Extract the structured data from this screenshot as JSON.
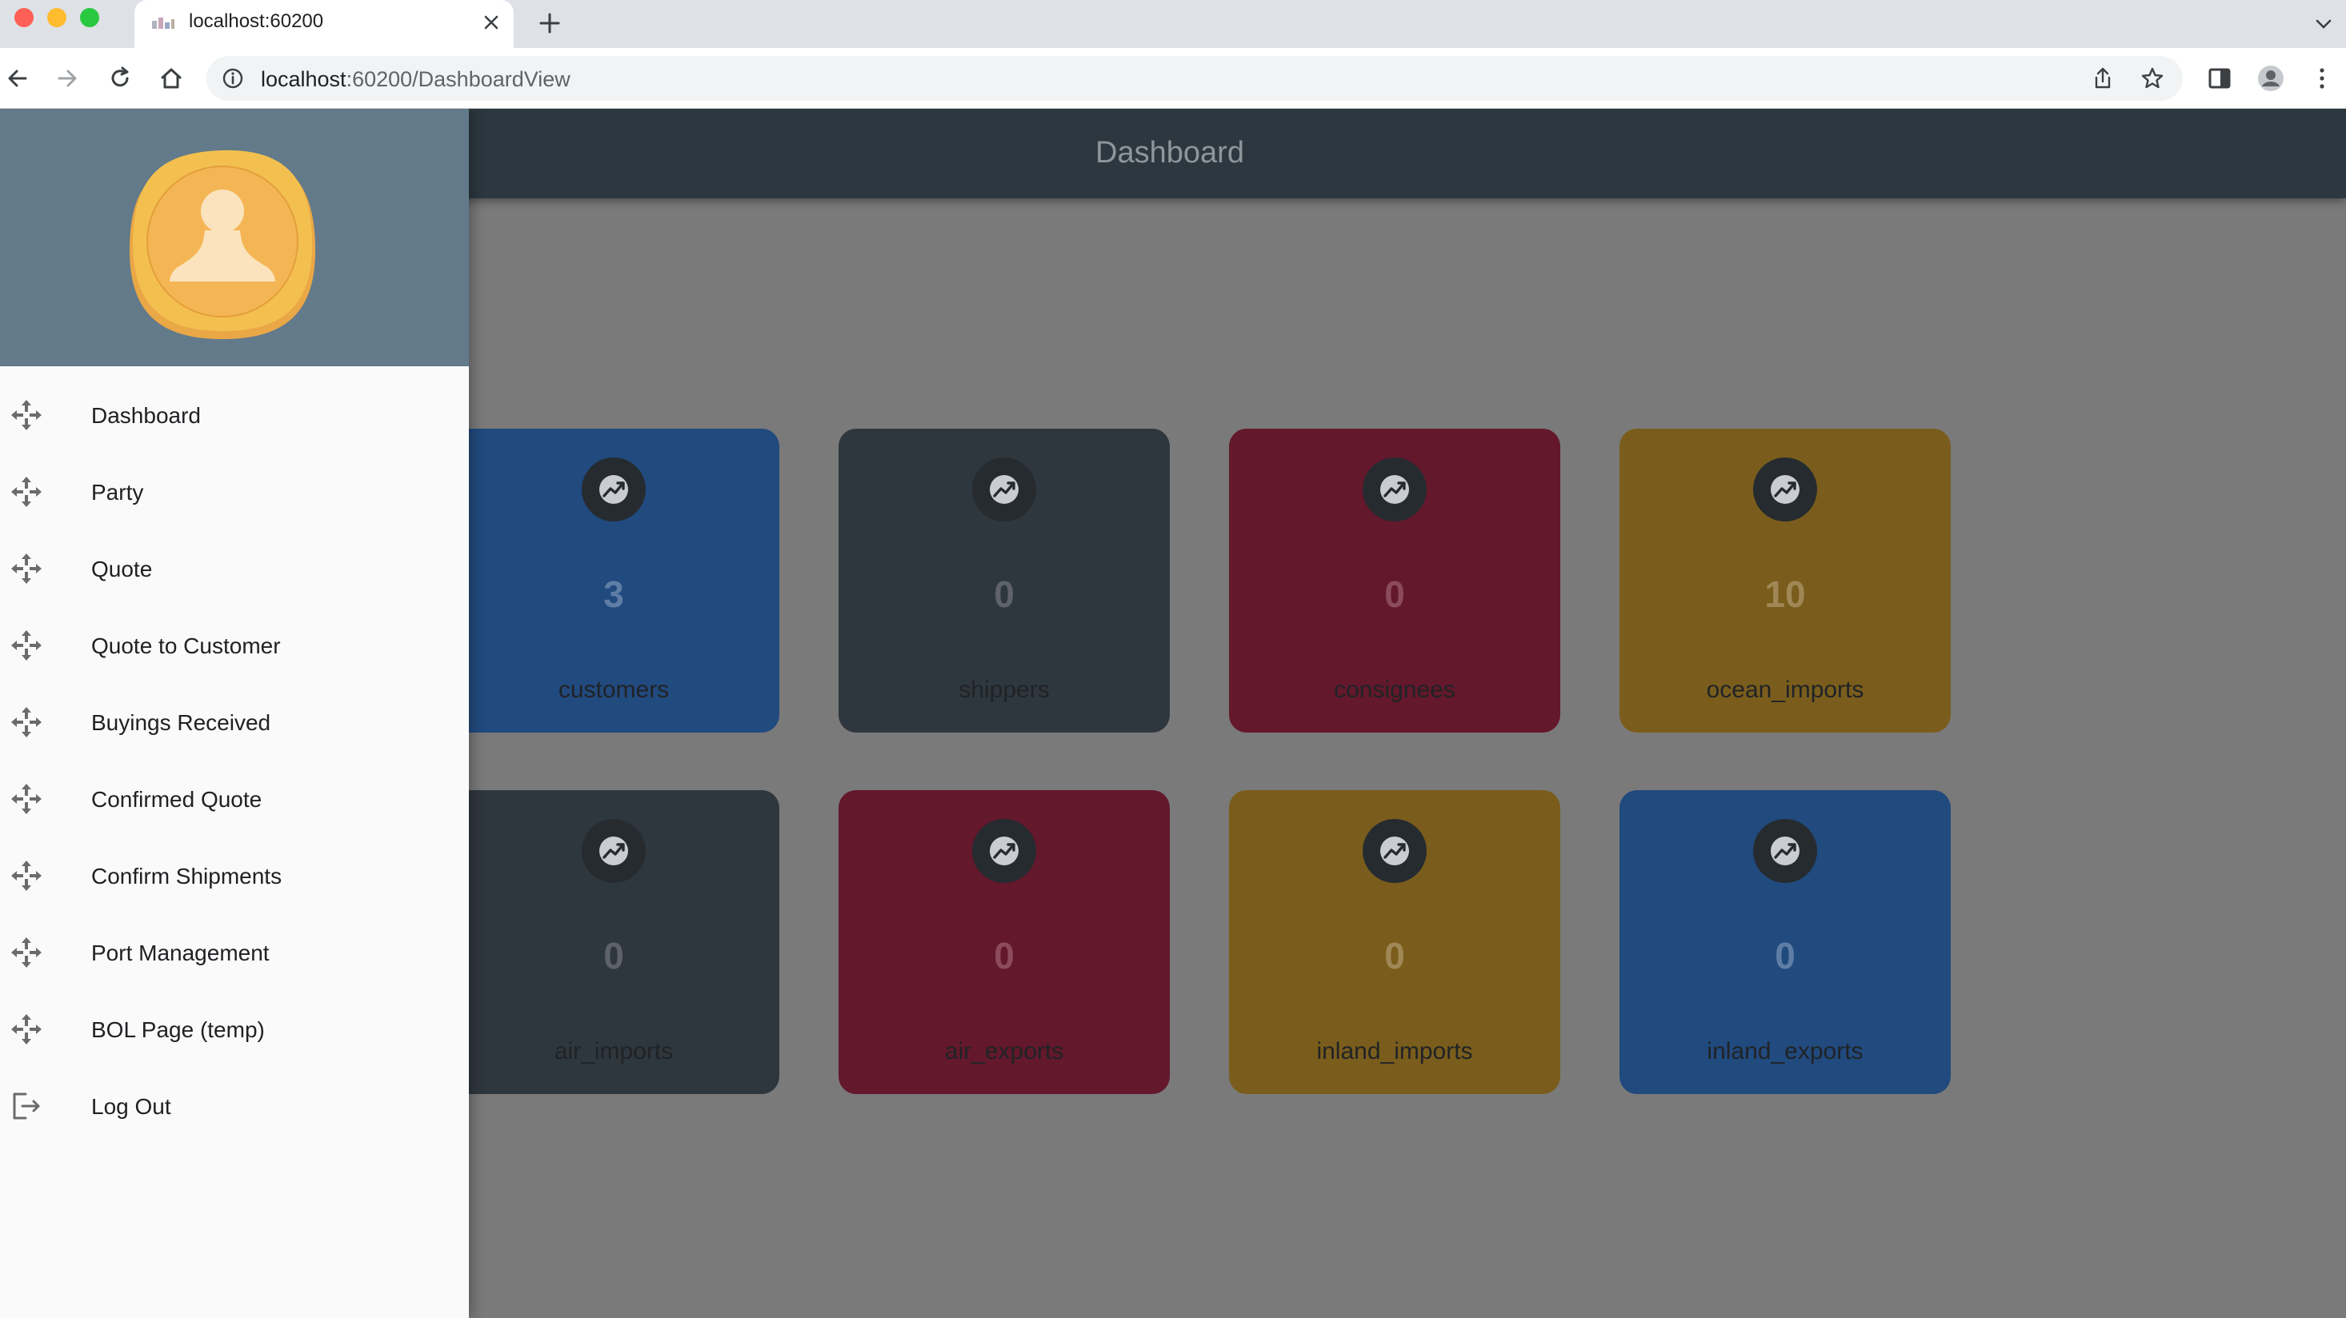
{
  "browser": {
    "tab_title": "localhost:60200",
    "url_host": "localhost",
    "url_path": ":60200/DashboardView",
    "icons": [
      "back-icon",
      "forward-icon",
      "reload-icon",
      "home-icon",
      "info-icon",
      "share-icon",
      "star-icon",
      "sidepanel-icon",
      "profile-icon",
      "kebab-menu-icon"
    ]
  },
  "app": {
    "title": "Dashboard"
  },
  "drawer": {
    "items": [
      {
        "label": "Dashboard",
        "icon": "move-icon"
      },
      {
        "label": "Party",
        "icon": "move-icon"
      },
      {
        "label": "Quote",
        "icon": "move-icon"
      },
      {
        "label": "Quote to Customer",
        "icon": "move-icon"
      },
      {
        "label": "Buyings Received",
        "icon": "move-icon"
      },
      {
        "label": "Confirmed Quote",
        "icon": "move-icon"
      },
      {
        "label": "Confirm Shipments",
        "icon": "move-icon"
      },
      {
        "label": "Port Management",
        "icon": "move-icon"
      },
      {
        "label": "BOL Page (temp)",
        "icon": "move-icon"
      },
      {
        "label": "Log Out",
        "icon": "logout-icon"
      }
    ]
  },
  "cards": [
    {
      "value": "",
      "label": "",
      "color": "#7a5d1c"
    },
    {
      "value": "3",
      "label": "customers",
      "color": "#214a7e"
    },
    {
      "value": "0",
      "label": "shippers",
      "color": "#2f373e"
    },
    {
      "value": "0",
      "label": "consignees",
      "color": "#63182c"
    },
    {
      "value": "10",
      "label": "ocean_imports",
      "color": "#7a5d1c"
    },
    {
      "value": "",
      "label": "",
      "color": "#214a7e"
    },
    {
      "value": "0",
      "label": "air_imports",
      "color": "#2f373e"
    },
    {
      "value": "0",
      "label": "air_exports",
      "color": "#63182c"
    },
    {
      "value": "0",
      "label": "inland_imports",
      "color": "#7a5d1c"
    },
    {
      "value": "0",
      "label": "inland_exports",
      "color": "#214a7e"
    }
  ],
  "colors": {
    "appbar": "#2c373f",
    "drawer_header": "#627a8a",
    "avatar": "#f3bf4f",
    "scrim": "#7a7a7a"
  }
}
